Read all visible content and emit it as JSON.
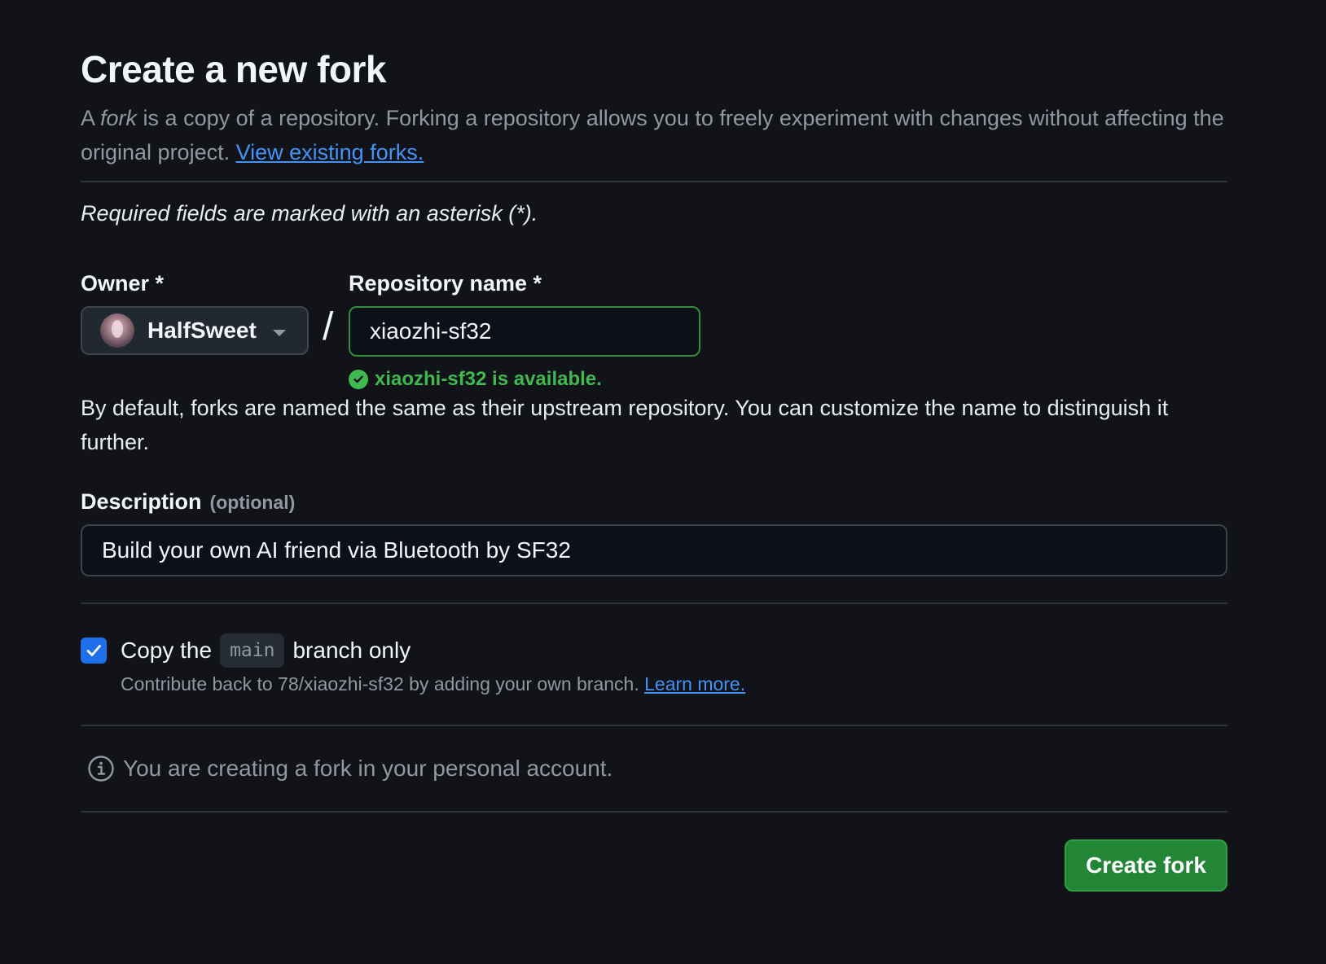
{
  "header": {
    "title": "Create a new fork",
    "intro_prefix": "A ",
    "intro_em": "fork",
    "intro_rest": " is a copy of a repository. Forking a repository allows you to freely experiment with changes without affecting the original project. ",
    "view_forks_link": "View existing forks."
  },
  "required_note": "Required fields are marked with an asterisk (*).",
  "owner": {
    "label": "Owner *",
    "selected": "HalfSweet"
  },
  "separator": "/",
  "repository": {
    "label": "Repository name *",
    "value": "xiaozhi-sf32",
    "availability": "xiaozhi-sf32 is available.",
    "status_color": "#3fb950"
  },
  "name_help": "By default, forks are named the same as their upstream repository. You can customize the name to distinguish it further.",
  "description": {
    "label": "Description",
    "optional": "(optional)",
    "value": "Build your own AI friend via Bluetooth by SF32"
  },
  "copy_branch": {
    "checked": true,
    "label_prefix": "Copy the",
    "branch": "main",
    "label_suffix": "branch only",
    "help_text": "Contribute back to 78/xiaozhi-sf32 by adding your own branch. ",
    "learn_more": "Learn more."
  },
  "info": {
    "icon": "info-icon",
    "text": "You are creating a fork in your personal account."
  },
  "actions": {
    "create_label": "Create fork",
    "create_color": "#238636"
  },
  "colors": {
    "background": "#111318",
    "link": "#4493f8",
    "checkbox": "#1f6feb"
  }
}
